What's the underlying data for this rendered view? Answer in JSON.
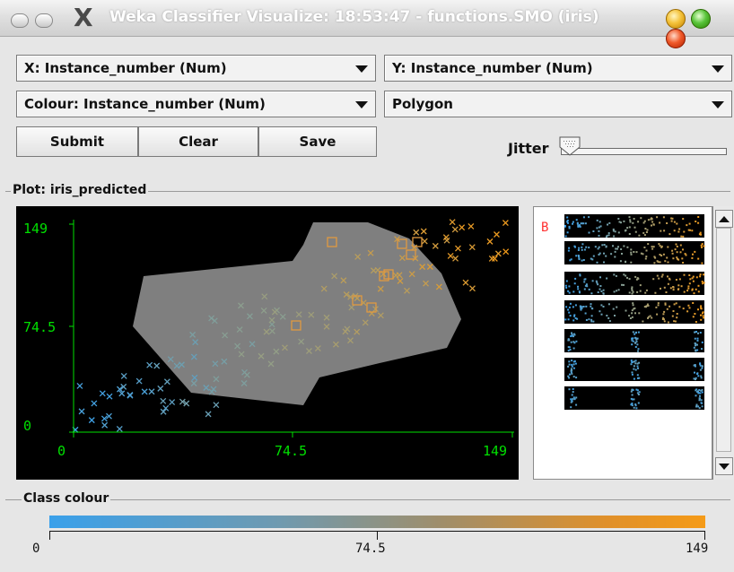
{
  "window": {
    "title": "Weka Classifier Visualize: 18:53:47 - functions.SMO (iris)"
  },
  "controls": {
    "x_axis": "X: Instance_number (Num)",
    "y_axis": "Y: Instance_number (Num)",
    "colour": "Colour: Instance_number (Num)",
    "shape": "Polygon",
    "submit_label": "Submit",
    "clear_label": "Clear",
    "save_label": "Save",
    "jitter_label": "Jitter",
    "jitter_value": 0
  },
  "plot": {
    "group_label": "Plot: iris_predicted",
    "y_ticks": [
      "149",
      "74.5",
      "0"
    ],
    "x_ticks": [
      "0",
      "74.5",
      "149"
    ],
    "axis_color": "#00e000",
    "polygon_color": "#8a8a8a"
  },
  "matrix": {
    "selected_label": "B",
    "selected_color": "#ff3030"
  },
  "class_colour": {
    "group_label": "Class colour",
    "start_label": "0",
    "mid_label": "74.5",
    "end_label": "149",
    "start_color": "#3aa0ea",
    "end_color": "#f59b18"
  }
}
